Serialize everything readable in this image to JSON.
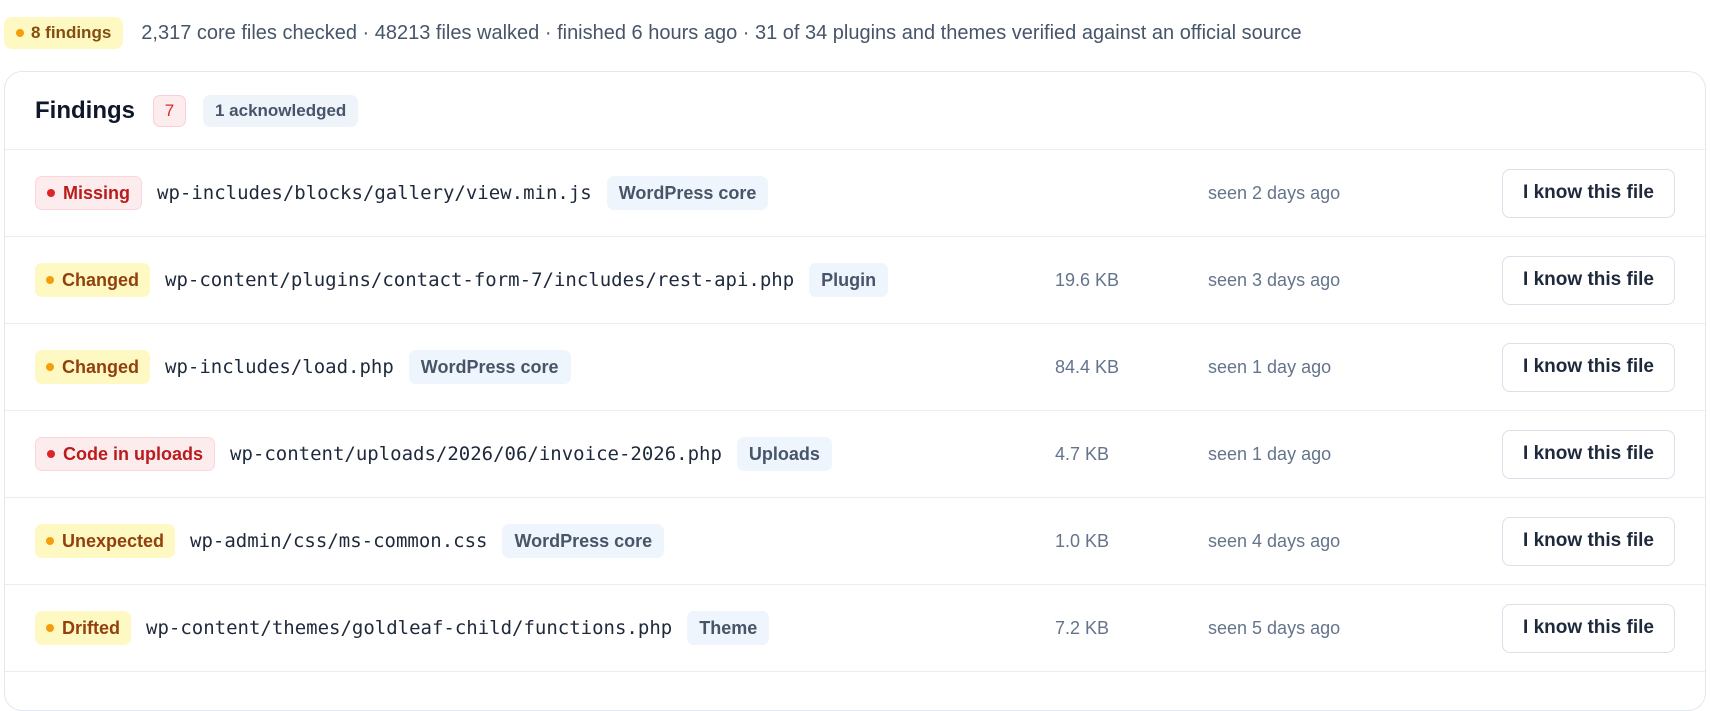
{
  "summary": {
    "badge": "8 findings",
    "text": "2,317 core files checked · 48213 files walked · finished 6 hours ago · 31 of 34 plugins and themes verified against an official source"
  },
  "findings": {
    "title": "Findings",
    "count": "7",
    "acknowledged": "1 acknowledged",
    "action_label": "I know this file",
    "rows": [
      {
        "status": "Missing",
        "tone": "red",
        "path": "wp-includes/blocks/gallery/view.min.js",
        "source": "WordPress core",
        "size": "",
        "seen": "seen 2 days ago"
      },
      {
        "status": "Changed",
        "tone": "amber",
        "path": "wp-content/plugins/contact-form-7/includes/rest-api.php",
        "source": "Plugin",
        "size": "19.6 KB",
        "seen": "seen 3 days ago"
      },
      {
        "status": "Changed",
        "tone": "amber",
        "path": "wp-includes/load.php",
        "source": "WordPress core",
        "size": "84.4 KB",
        "seen": "seen 1 day ago"
      },
      {
        "status": "Code in uploads",
        "tone": "red",
        "path": "wp-content/uploads/2026/06/invoice-2026.php",
        "source": "Uploads",
        "size": "4.7 KB",
        "seen": "seen 1 day ago"
      },
      {
        "status": "Unexpected",
        "tone": "amber",
        "path": "wp-admin/css/ms-common.css",
        "source": "WordPress core",
        "size": "1.0 KB",
        "seen": "seen 4 days ago"
      },
      {
        "status": "Drifted",
        "tone": "amber",
        "path": "wp-content/themes/goldleaf-child/functions.php",
        "source": "Theme",
        "size": "7.2 KB",
        "seen": "seen 5 days ago"
      }
    ]
  },
  "colors": {
    "amber_dot": "#f59e0b",
    "red_dot": "#dc2626"
  }
}
